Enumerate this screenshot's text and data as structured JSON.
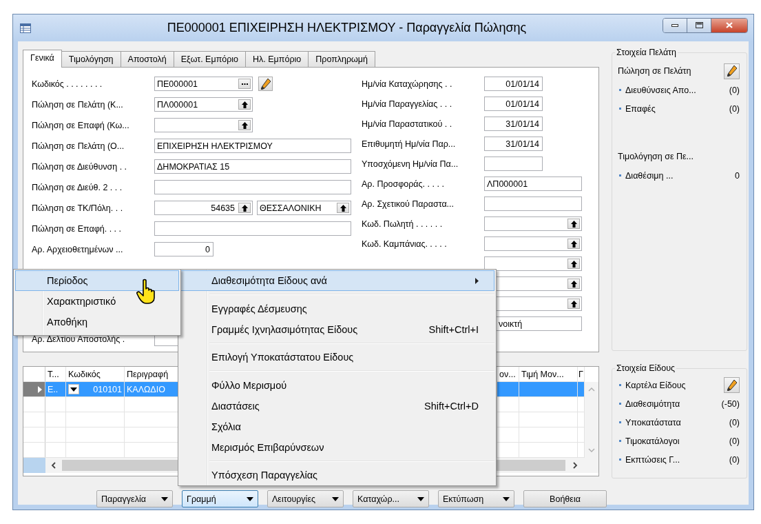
{
  "window": {
    "title": "ΠΕ000001 ΕΠΙΧΕΙΡΗΣΗ ΗΛΕΚΤΡΙΣΜΟΥ - Παραγγελία Πώλησης"
  },
  "tabs": [
    {
      "label": "Γενικά",
      "selected": true
    },
    {
      "label": "Τιμολόγηση",
      "selected": false
    },
    {
      "label": "Αποστολή",
      "selected": false
    },
    {
      "label": "Εξωτ. Εμπόριο",
      "selected": false
    },
    {
      "label": "Ηλ. Εμπόριο",
      "selected": false
    },
    {
      "label": "Προπληρωμή",
      "selected": false
    }
  ],
  "form": {
    "left_fields": [
      {
        "label": "Κωδικός . . . . . . . .",
        "kind": "code",
        "value": "ΠΕ000001"
      },
      {
        "label": "Πώληση σε Πελάτη (Κ...",
        "kind": "lookup",
        "value": "ΠΛ000001"
      },
      {
        "label": "Πώληση σε Επαφή (Κω...",
        "kind": "lookup"
      },
      {
        "label": "Πώληση σε Πελάτη (Ο...",
        "kind": "text",
        "value": "ΕΠΙΧΕΙΡΗΣΗ ΗΛΕΚΤΡΙΣΜΟΥ"
      },
      {
        "label": "Πώληση σε Διεύθυνση . .",
        "kind": "text",
        "value": "ΔΗΜΟΚΡΑΤΙΑΣ 15"
      },
      {
        "label": "Πώληση σε Διεύθ. 2 . . .",
        "kind": "text"
      },
      {
        "label": "Πώληση σε ΤΚ/Πόλη. . .",
        "kind": "postal",
        "value": "54635",
        "city": "ΘΕΣΣΑΛΟΝΙΚΗ"
      },
      {
        "label": "Πώληση σε Επαφή. . . .",
        "kind": "text"
      },
      {
        "label": "Αρ. Αρχειοθετημένων ...",
        "kind": "number",
        "value": "0"
      },
      {
        "label": "Αρ. Δελτίου Αποστολής .",
        "kind": "number"
      }
    ],
    "right_fields": [
      {
        "label": "Ημ/νία Καταχώρησης . .",
        "kind": "date",
        "value": "01/01/14"
      },
      {
        "label": "Ημ/νία Παραγγελίας . . .",
        "kind": "date",
        "value": "01/01/14"
      },
      {
        "label": "Ημ/νία Παραστατικού . .",
        "kind": "date",
        "value": "31/01/14"
      },
      {
        "label": "Επιθυμητή Ημ/νία Παρ...",
        "kind": "date",
        "value": "31/01/14"
      },
      {
        "label": "Υποσχόμενη Ημ/νία Πα...",
        "kind": "date"
      },
      {
        "label": "Αρ. Προσφοράς. . . . .",
        "kind": "text",
        "value": "ΛΠ000001"
      },
      {
        "label": "Αρ. Σχετικού Παραστα...",
        "kind": "text"
      },
      {
        "label": "Κωδ. Πωλητή . . . . . .",
        "kind": "lookup"
      },
      {
        "label": "Κωδ. Καμπάνιας. . . . .",
        "kind": "lookup"
      },
      {
        "kind": "lookup"
      },
      {
        "kind": "lookup"
      },
      {
        "kind": "lookup"
      },
      {
        "kind": "text",
        "value": "νοικτή"
      }
    ]
  },
  "grid": {
    "columns": [
      {
        "label": "Τ..."
      },
      {
        "label": "Κωδικός"
      },
      {
        "label": "Περιγραφή"
      },
      {
        "label": "ον..."
      },
      {
        "label": "Τιμή Μον..."
      },
      {
        "label": "Γ"
      }
    ],
    "rows": [
      {
        "selected": true,
        "cells": [
          "Ε..",
          "010101",
          "ΚΑΛΩΔΙΟ"
        ]
      },
      {
        "selected": false
      },
      {
        "selected": false
      },
      {
        "selected": false
      },
      {
        "selected": false
      }
    ]
  },
  "customer_panel": {
    "title": "Στοιχεία Πελάτη",
    "items": [
      {
        "kind": "heading",
        "label": "Πώληση σε Πελάτη",
        "edit": true
      },
      {
        "kind": "link",
        "label": "Διευθύνσεις Απο...",
        "count": "(0)"
      },
      {
        "kind": "link",
        "label": "Επαφές",
        "count": "(0)"
      },
      {
        "kind": "heading",
        "label": "Τιμολόγηση σε Πε...",
        "edit": false
      },
      {
        "kind": "link",
        "label": "Διαθέσιμη ...",
        "count": "0"
      }
    ]
  },
  "item_panel": {
    "title": "Στοιχεία Είδους",
    "items": [
      {
        "kind": "link",
        "label": "Καρτέλα Είδους",
        "edit": true
      },
      {
        "kind": "link",
        "label": "Διαθεσιμότητα",
        "count": "(-50)"
      },
      {
        "kind": "link",
        "label": "Υποκατάστατα",
        "count": "(0)"
      },
      {
        "kind": "link",
        "label": "Τιμοκατάλογοι",
        "count": "(0)"
      },
      {
        "kind": "link",
        "label": "Εκπτώσεις Γ...",
        "count": "(0)"
      }
    ]
  },
  "buttons": [
    {
      "label": "Παραγγελία",
      "dropdown": true,
      "selected": false
    },
    {
      "label": "Γραμμή",
      "dropdown": true,
      "selected": true
    },
    {
      "label": "Λειτουργίες",
      "dropdown": true,
      "selected": false
    },
    {
      "label": "Καταχώρ...",
      "dropdown": true,
      "selected": false
    },
    {
      "label": "Εκτύπωση",
      "dropdown": true,
      "selected": false
    },
    {
      "label": "Βοήθεια",
      "dropdown": false,
      "selected": false
    }
  ],
  "context_menu": {
    "items": [
      {
        "kind": "submenu",
        "label": "Διαθεσιμότητα Είδους ανά",
        "selected": true
      },
      {
        "kind": "separator"
      },
      {
        "kind": "item",
        "label": "Εγγραφές Δέσμευσης",
        "selected": false
      },
      {
        "kind": "item",
        "label": "Γραμμές Ιχνηλασιμότητας Είδους",
        "shortcut": "Shift+Ctrl+I",
        "selected": false
      },
      {
        "kind": "separator"
      },
      {
        "kind": "item",
        "label": "Επιλογή Υποκατάστατου Είδους",
        "selected": false
      },
      {
        "kind": "separator"
      },
      {
        "kind": "item",
        "label": "Φύλλο Μερισμού",
        "selected": false
      },
      {
        "kind": "item",
        "label": "Διαστάσεις",
        "shortcut": "Shift+Ctrl+D",
        "selected": false
      },
      {
        "kind": "item",
        "label": "Σχόλια",
        "selected": false
      },
      {
        "kind": "item",
        "label": "Μερισμός Επιβαρύνσεων",
        "selected": false
      },
      {
        "kind": "separator"
      },
      {
        "kind": "item",
        "label": "Υπόσχεση Παραγγελίας",
        "selected": false
      }
    ]
  },
  "submenu": {
    "items": [
      {
        "kind": "item",
        "label": "Περίοδος",
        "selected": true
      },
      {
        "kind": "item",
        "label": "Χαρακτηριστικό",
        "selected": false
      },
      {
        "kind": "item",
        "label": "Αποθήκη",
        "selected": false
      }
    ]
  }
}
